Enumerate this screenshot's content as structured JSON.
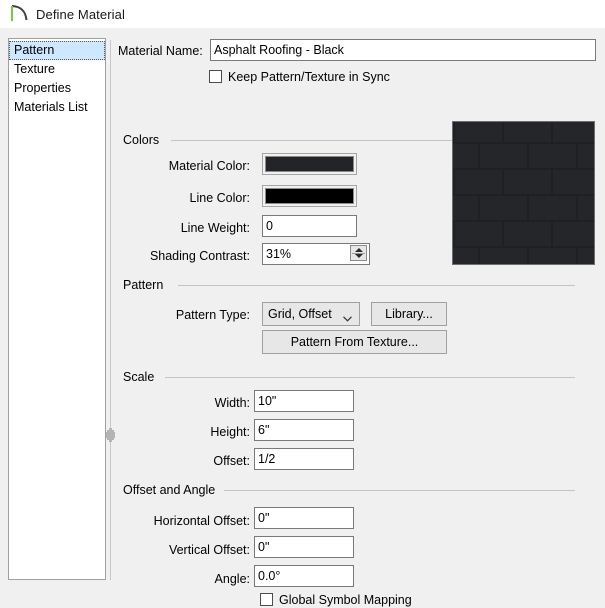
{
  "window": {
    "title": "Define Material",
    "icon": "arc-material-icon"
  },
  "sidebar": {
    "items": [
      {
        "label": "Pattern",
        "selected": true
      },
      {
        "label": "Texture",
        "selected": false
      },
      {
        "label": "Properties",
        "selected": false
      },
      {
        "label": "Materials List",
        "selected": false
      }
    ]
  },
  "form": {
    "material_name": {
      "label": "Material Name:",
      "value": "Asphalt Roofing - Black"
    },
    "keep_in_sync": {
      "label": "Keep Pattern/Texture in Sync",
      "checked": false
    },
    "groups": {
      "colors": "Colors",
      "pattern": "Pattern",
      "scale": "Scale",
      "offset_and_angle": "Offset and Angle"
    },
    "colors": {
      "material_color": {
        "label": "Material Color:",
        "value": "#232427"
      },
      "line_color": {
        "label": "Line Color:",
        "value": "#000000"
      },
      "line_weight": {
        "label": "Line Weight:",
        "value": "0"
      },
      "shading_contrast": {
        "label": "Shading Contrast:",
        "value": "31%"
      }
    },
    "pattern": {
      "pattern_type": {
        "label": "Pattern Type:",
        "value": "Grid, Offset"
      },
      "library_button": "Library...",
      "pattern_from_texture_button": "Pattern From Texture..."
    },
    "scale": {
      "width": {
        "label": "Width:",
        "value": "10\""
      },
      "height": {
        "label": "Height:",
        "value": "6\""
      },
      "offset": {
        "label": "Offset:",
        "value": "1/2"
      }
    },
    "offset_and_angle": {
      "horizontal_offset": {
        "label": "Horizontal Offset:",
        "value": "0\""
      },
      "vertical_offset": {
        "label": "Vertical Offset:",
        "value": "0\""
      },
      "angle": {
        "label": "Angle:",
        "value": "0.0°"
      },
      "global_symbol_mapping": {
        "label": "Global Symbol Mapping",
        "checked": false
      }
    }
  },
  "preview": {
    "name": "material-pattern-preview",
    "background_color": "#1f2023",
    "brick_color": "#24262a",
    "pattern": "grid-offset"
  }
}
